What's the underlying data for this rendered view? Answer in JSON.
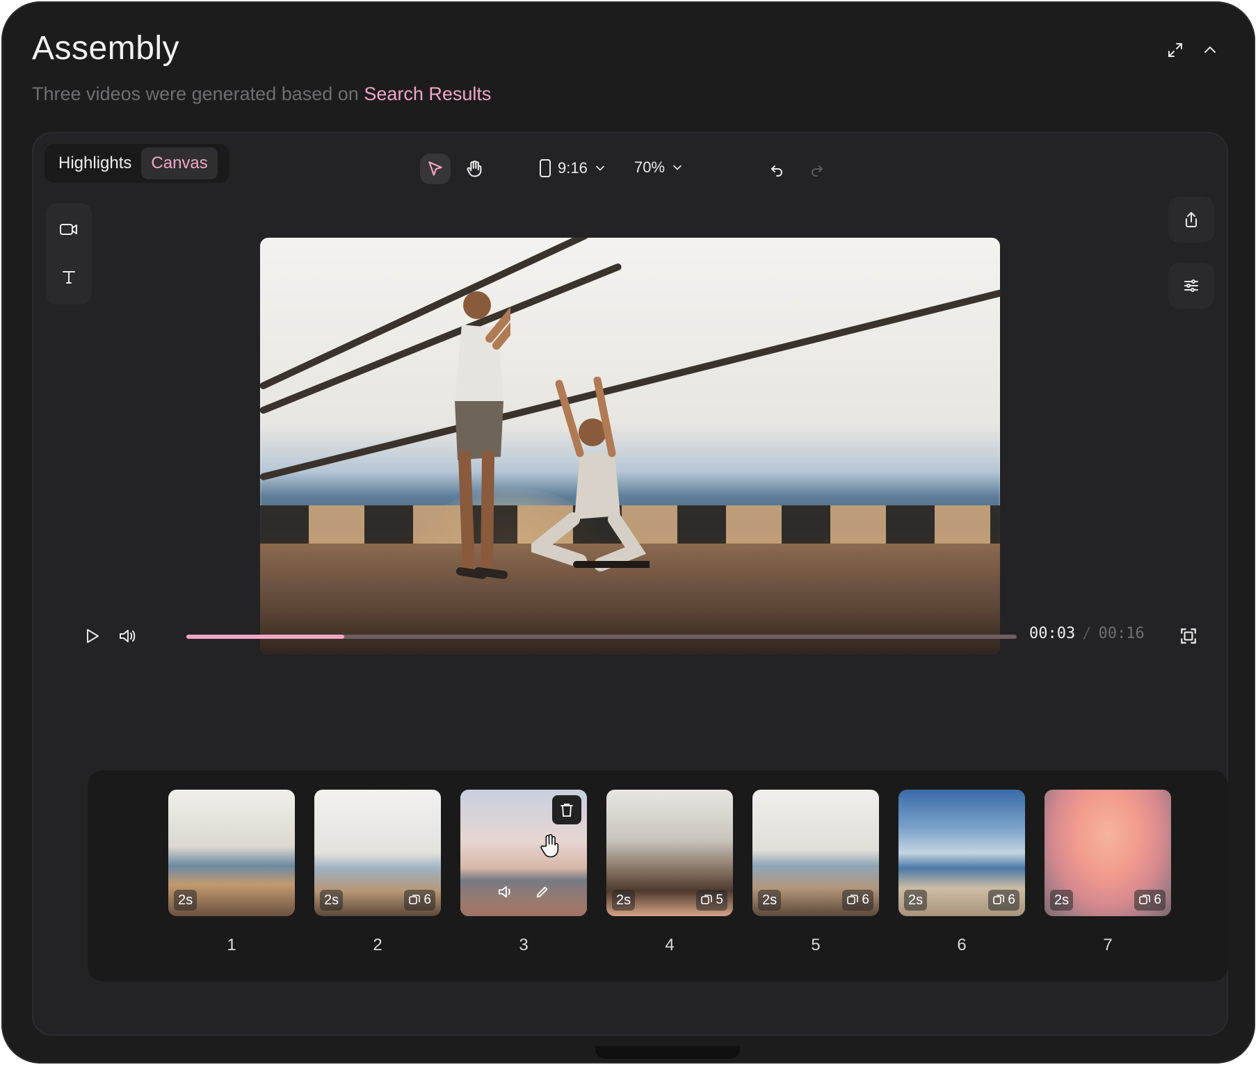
{
  "header": {
    "title": "Assembly",
    "subtitle_prefix": "Three videos were generated based on",
    "subtitle_link": "Search Results",
    "expand_icon": "expand-icon",
    "collapse_icon": "chevron-up-icon"
  },
  "tabs": [
    {
      "label": "Highlights",
      "active": false
    },
    {
      "label": "Canvas",
      "active": true
    }
  ],
  "toolbar": {
    "tools": [
      "pointer-icon",
      "hand-icon"
    ],
    "aspect": "9:16",
    "zoom": "70%",
    "undo_icon": "undo-icon",
    "redo_icon": "redo-icon"
  },
  "left_tools": [
    "video-camera-icon",
    "text-icon"
  ],
  "right_tools": [
    "share-icon",
    "sliders-icon"
  ],
  "player": {
    "current": "00:03",
    "separator": "/",
    "total": "00:16",
    "progress": 0.19
  },
  "clips": [
    {
      "number": "1",
      "duration": "2s",
      "count": ""
    },
    {
      "number": "2",
      "duration": "2s",
      "count": "6"
    },
    {
      "number": "3",
      "duration": "",
      "count": "",
      "selected": true
    },
    {
      "number": "4",
      "duration": "2s",
      "count": "5"
    },
    {
      "number": "5",
      "duration": "2s",
      "count": "6"
    },
    {
      "number": "6",
      "duration": "2s",
      "count": "6"
    },
    {
      "number": "7",
      "duration": "2s",
      "count": "6"
    }
  ],
  "colors": {
    "accent": "#f2a6c6",
    "background": "#1c1c1d",
    "card": "#232325"
  }
}
